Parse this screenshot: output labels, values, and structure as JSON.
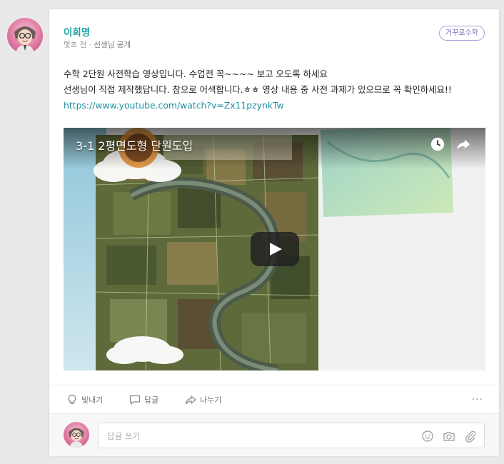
{
  "post": {
    "author": "이희명",
    "time": "몇초 전",
    "separator": " · ",
    "visibility": "선생님 공개",
    "badge": "거꾸로수학",
    "line1": "수학 2단원 사전학습 영상입니다. 수업전 꼭~~~~ 보고 오도록 하세요",
    "line2": "선생님이 직접 제작했답니다. 참으로 어색합니다.ㅎㅎ 영상 내용 중 사전 과제가 있으므로 꼭 확인하세요!!",
    "link": "https://www.youtube.com/watch?v=Zx11pzynkTw"
  },
  "video": {
    "title": "3-1 2평면도형 단원도입",
    "icons": [
      "clock-icon",
      "share-arrow-icon",
      "play-icon"
    ]
  },
  "actions": {
    "like": "빛내기",
    "comment": "답글",
    "share": "나누기",
    "more": "···"
  },
  "comment": {
    "placeholder": "답글 쓰기",
    "icons": [
      "emoji-icon",
      "camera-icon",
      "attach-icon"
    ]
  },
  "colors": {
    "accent": "#1aa3a0",
    "badge": "#7a6fb8",
    "link": "#1f8fa0"
  }
}
